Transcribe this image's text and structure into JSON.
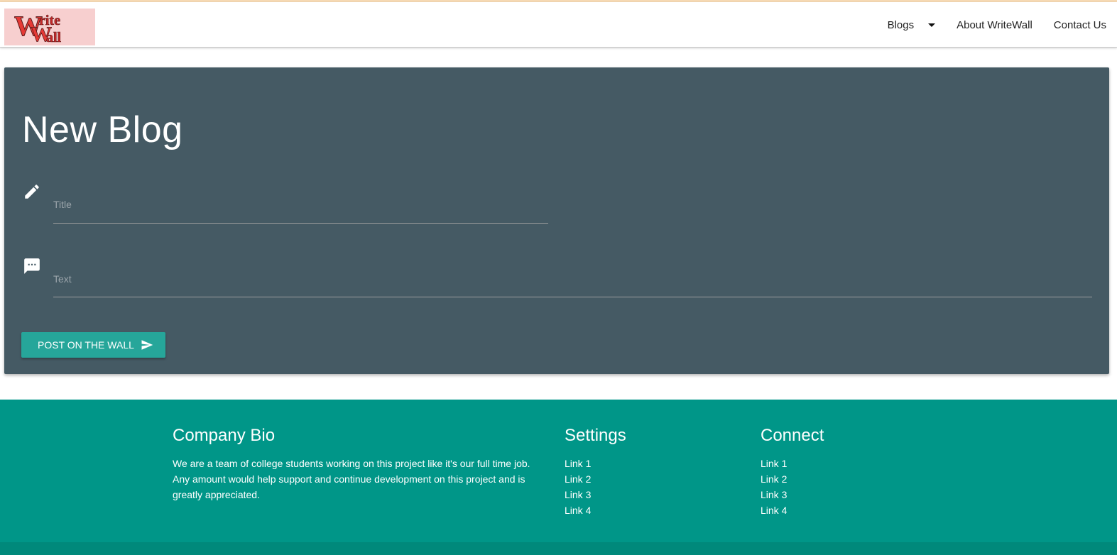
{
  "header": {
    "logo_text_line1": "rite",
    "logo_text_line2": "all",
    "nav": {
      "blogs": "Blogs",
      "about": "About WriteWall",
      "contact": "Contact Us"
    }
  },
  "form": {
    "heading": "New Blog",
    "title_placeholder": "Title",
    "text_placeholder": "Text",
    "submit_label": "POST ON THE WALL",
    "icons": {
      "title": "pencil-icon",
      "text": "chat-icon",
      "submit": "send-icon"
    }
  },
  "footer": {
    "bio": {
      "heading": "Company Bio",
      "text": "We are a team of college students working on this project like it's our full time job. Any amount would help support and continue development on this project and is greatly appreciated."
    },
    "settings": {
      "heading": "Settings",
      "links": [
        "Link 1",
        "Link 2",
        "Link 3",
        "Link 4"
      ]
    },
    "connect": {
      "heading": "Connect",
      "links": [
        "Link 1",
        "Link 2",
        "Link 3",
        "Link 4"
      ]
    }
  },
  "colors": {
    "card": "#455a64",
    "button": "#26a69a",
    "footer": "#009688",
    "logo_bg": "#f7cfcf",
    "logo_text": "#e53935"
  }
}
